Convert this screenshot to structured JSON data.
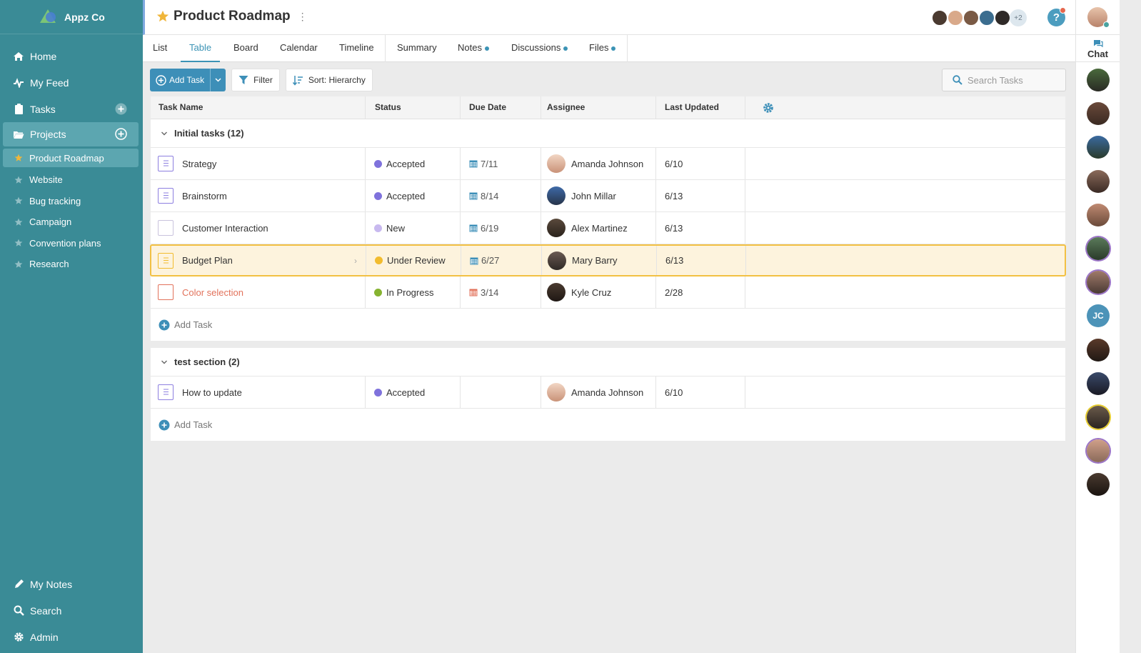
{
  "brand": {
    "name": "Appz Co"
  },
  "nav": {
    "home": "Home",
    "feed": "My Feed",
    "tasks": "Tasks",
    "projects": "Projects",
    "notes": "My Notes",
    "search": "Search",
    "admin": "Admin"
  },
  "projects": [
    "Product Roadmap",
    "Website",
    "Bug tracking",
    "Campaign",
    "Convention plans",
    "Research"
  ],
  "header": {
    "title": "Product Roadmap",
    "more_members": "+2",
    "help": "?"
  },
  "tabs": [
    "List",
    "Table",
    "Board",
    "Calendar",
    "Timeline",
    "Summary",
    "Notes",
    "Discussions",
    "Files"
  ],
  "toolbar": {
    "add_task": "Add Task",
    "filter": "Filter",
    "sort": "Sort: Hierarchy",
    "search_placeholder": "Search Tasks"
  },
  "columns": [
    "Task Name",
    "Status",
    "Due Date",
    "Assignee",
    "Last Updated"
  ],
  "sections": [
    {
      "title": "Initial tasks (12)",
      "rows": [
        {
          "name": "Strategy",
          "status": "Accepted",
          "due": "7/11",
          "assignee": "Amanda Johnson",
          "updated": "6/10"
        },
        {
          "name": "Brainstorm",
          "status": "Accepted",
          "due": "8/14",
          "assignee": "John Millar",
          "updated": "6/13"
        },
        {
          "name": "Customer Interaction",
          "status": "New",
          "due": "6/19",
          "assignee": "Alex Martinez",
          "updated": "6/13"
        },
        {
          "name": "Budget Plan",
          "status": "Under Review",
          "due": "6/27",
          "assignee": "Mary Barry",
          "updated": "6/13"
        },
        {
          "name": "Color selection",
          "status": "In Progress",
          "due": "3/14",
          "assignee": "Kyle Cruz",
          "updated": "2/28"
        }
      ],
      "add_label": "Add Task"
    },
    {
      "title": "test section (2)",
      "rows": [
        {
          "name": "How to update",
          "status": "Accepted",
          "due": "",
          "assignee": "Amanda Johnson",
          "updated": "6/10"
        }
      ],
      "add_label": "Add Task"
    }
  ],
  "chat": {
    "label": "Chat",
    "initials": "JC"
  },
  "colors": {
    "sidebar": "#3a8b96",
    "accent": "#3b93b5",
    "accepted": "#7f72dc",
    "new": "#c8b9ef",
    "under_review": "#f2bc2e",
    "in_progress": "#86b331",
    "overdue": "#e2725b"
  }
}
